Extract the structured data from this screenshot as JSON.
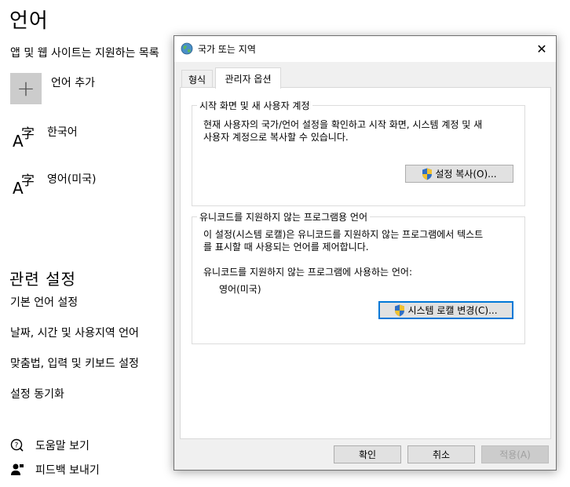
{
  "settings": {
    "title": "언어",
    "description": "앱 및 웹 사이트는 지원하는 목록",
    "add_language_label": "언어 추가",
    "languages": [
      {
        "label": "한국어",
        "glyph_a": "A",
        "glyph_zi": "字"
      },
      {
        "label": "영어(미국)",
        "glyph_a": "A",
        "glyph_zi": "字"
      }
    ],
    "related_title": "관련 설정",
    "related_links": [
      "기본 언어 설정",
      "날짜, 시간 및 사용지역 언어",
      "맞춤법, 입력 및 키보드 설정",
      "설정 동기화"
    ],
    "help_label": "도움말 보기",
    "feedback_label": "피드백 보내기"
  },
  "dialog": {
    "title": "국가 또는 지역",
    "close_glyph": "✕",
    "tabs": [
      {
        "label": "형식",
        "active": false
      },
      {
        "label": "관리자 옵션",
        "active": true
      }
    ],
    "welcome_group": {
      "legend": "시작 화면 및 새 사용자 계정",
      "text_line1": "현재 사용자의 국가/언어 설정을 확인하고 시작 화면, 시스템 계정 및 새",
      "text_line2": "사용자 계정으로 복사할 수 있습니다.",
      "button_label": "설정 복사(O)..."
    },
    "unicode_group": {
      "legend": "유니코드를 지원하지 않는 프로그램용 언어",
      "text_line1": "이 설정(시스템 로캘)은 유니코드를 지원하지 않는 프로그램에서 텍스트",
      "text_line2": "를 표시할 때 사용되는 언어를 제어합니다.",
      "current_label": "유니코드를 지원하지 않는 프로그램에 사용하는 언어:",
      "current_value": "영어(미국)",
      "button_label": "시스템 로캘 변경(C)..."
    },
    "buttons": {
      "ok": "확인",
      "cancel": "취소",
      "apply": "적용(A)"
    },
    "colors": {
      "focus_border": "#0078d7",
      "panel_bg": "#f0f0f0"
    }
  }
}
